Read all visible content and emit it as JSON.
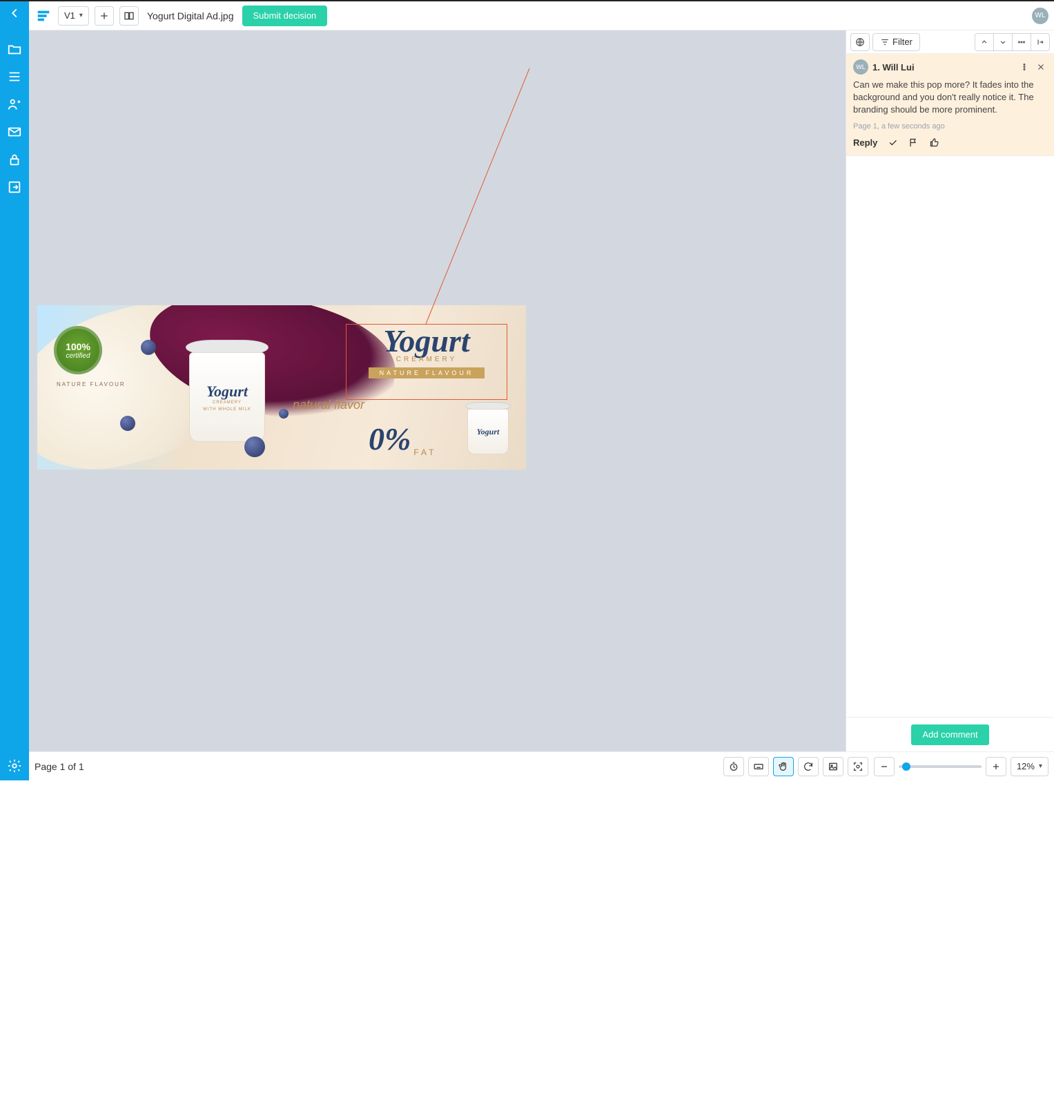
{
  "topbar": {
    "version_label": "V1",
    "filename": "Yogurt Digital Ad.jpg",
    "submit_label": "Submit decision",
    "avatar_initials": "WL"
  },
  "panel": {
    "filter_label": "Filter"
  },
  "comment": {
    "avatar_initials": "WL",
    "author": "1. Will Lui",
    "body": "Can we make this pop more? It fades into the background and you don't really notice it. The branding should be more prominent.",
    "meta": "Page 1, a few seconds ago",
    "reply_label": "Reply"
  },
  "panel_footer": {
    "add_comment_label": "Add comment"
  },
  "bottombar": {
    "page_info": "Page 1 of 1",
    "zoom_value": "12%"
  },
  "ad": {
    "cert_line1": "100%",
    "cert_line2": "certified",
    "nature_flavour_small": "NATURE FLAVOUR",
    "brand": "Yogurt",
    "sub_brand": "CREAMERY",
    "whole_milk": "WITH WHOLE MILK",
    "natural_flavor": "natural flavor",
    "zero": "0%",
    "fat": "FAT",
    "ribbon": "NATURE FLAVOUR"
  }
}
